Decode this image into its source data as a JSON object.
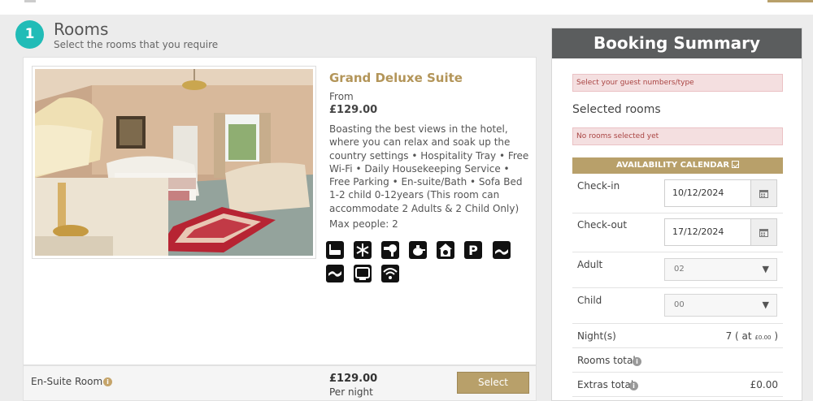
{
  "step": {
    "number": "1",
    "title": "Rooms",
    "subtitle": "Select the rooms that you require"
  },
  "room": {
    "name": "Grand Deluxe Suite",
    "from_label": "From",
    "price": "£129.00",
    "description": "Boasting the best views in the hotel, where you can relax and soak up the country settings • Hospitality Tray • Free Wi-Fi • Daily Housekeeping Service • Free Parking • En-suite/Bath • Sofa Bed 1-2 child 0-12years (This room can accommodate 2 Adults & 2 Child Only)",
    "max_people": "Max people: 2",
    "amenity_icons": [
      "bath-icon",
      "air-conditioning-icon",
      "hairdryer-icon",
      "tea-kettle-icon",
      "safe-icon",
      "parking-icon",
      "sofa-bed-icon",
      "sofa-bed-icon",
      "tv-icon",
      "wifi-icon"
    ]
  },
  "rate": {
    "name": "En-Suite Room",
    "info": "i",
    "price": "£129.00",
    "per": "Per night",
    "select_label": "Select"
  },
  "summary": {
    "title": "Booking Summary",
    "guest_alert": "Select your guest numbers/type",
    "selected_rooms_title": "Selected rooms",
    "rooms_alert": "No rooms selected yet",
    "availability_label": "AVAILABILITY CALENDAR",
    "checkin_label": "Check-in",
    "checkin_value": "10/12/2024",
    "checkout_label": "Check-out",
    "checkout_value": "17/12/2024",
    "adult_label": "Adult",
    "adult_value": "02",
    "child_label": "Child",
    "child_value": "00",
    "select_arrow": "▼",
    "nights_label": "Night(s)",
    "nights_value": "7",
    "nights_at_open": "( at",
    "nights_rate": "£0.00",
    "nights_close": ")",
    "rooms_total_label": "Rooms total",
    "extras_total_label": "Extras total",
    "extras_total_value": "£0.00"
  },
  "colors": {
    "accent": "#b8a06a",
    "step": "#21bcb7",
    "header": "#5b5d5e",
    "alert_bg": "#f4dfe0",
    "alert_text": "#a94442"
  }
}
